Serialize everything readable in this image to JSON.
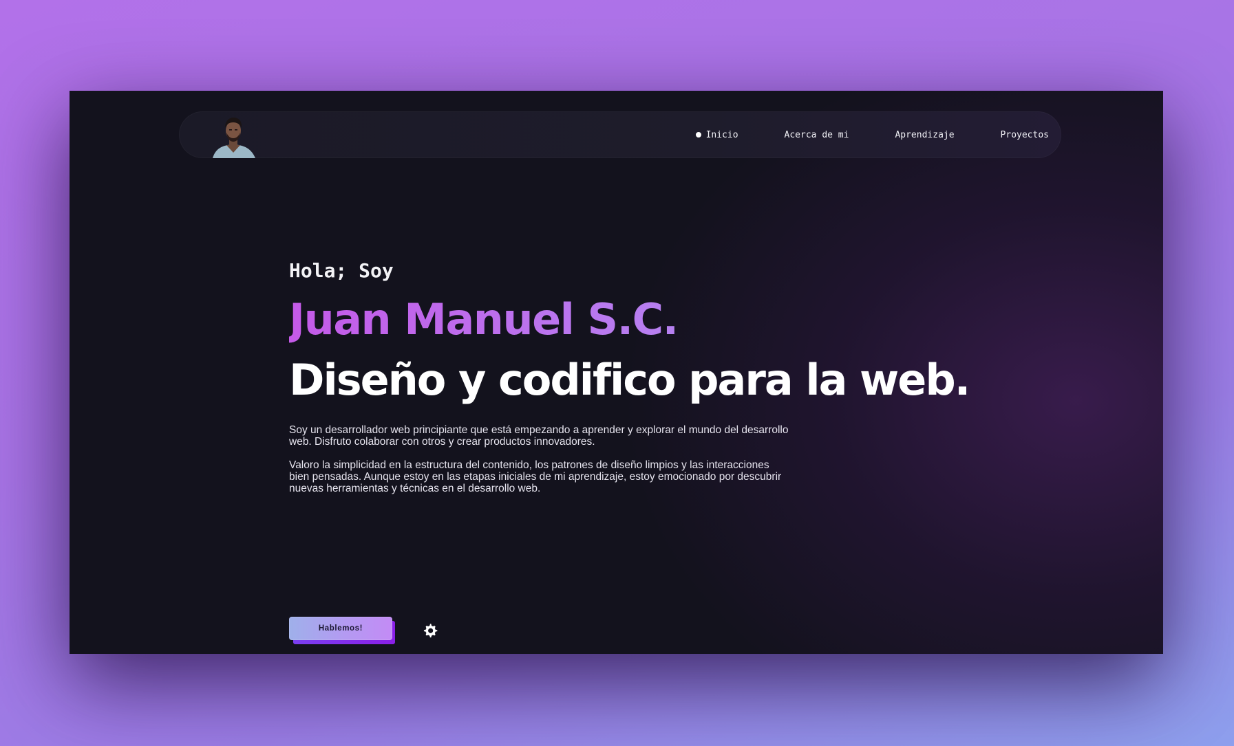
{
  "nav": {
    "items": [
      {
        "label": "Inicio",
        "active": true
      },
      {
        "label": "Acerca de mi",
        "active": false
      },
      {
        "label": "Aprendizaje",
        "active": false
      },
      {
        "label": "Proyectos",
        "active": false
      }
    ]
  },
  "hero": {
    "greeting": "Hola; Soy",
    "name": "Juan Manuel S.C.",
    "tagline": "Diseño y codifico para la web.",
    "paragraph1": "Soy un desarrollador web principiante que está empezando a aprender y explorar el mundo del desarrollo web. Disfruto colaborar con otros y crear productos innovadores.",
    "paragraph2": "Valoro la simplicidad en la estructura del contenido, los patrones de diseño limpios y las interacciones bien pensadas. Aunque estoy en las etapas iniciales de mi aprendizaje, estoy emocionado por descubrir nuevas herramientas y técnicas en el desarrollo web.",
    "cta_label": "Hablemos!"
  },
  "icons": {
    "avatar": "avatar-illustration",
    "settings": "gear-icon"
  },
  "colors": {
    "page_background_start": "#b271e9",
    "page_background_end": "#8ea0ee",
    "window_background": "#13121d",
    "accent_gradient_start": "#c45ae8",
    "accent_gradient_end": "#a28ff2",
    "cta_shadow": "#7b3ff1"
  }
}
